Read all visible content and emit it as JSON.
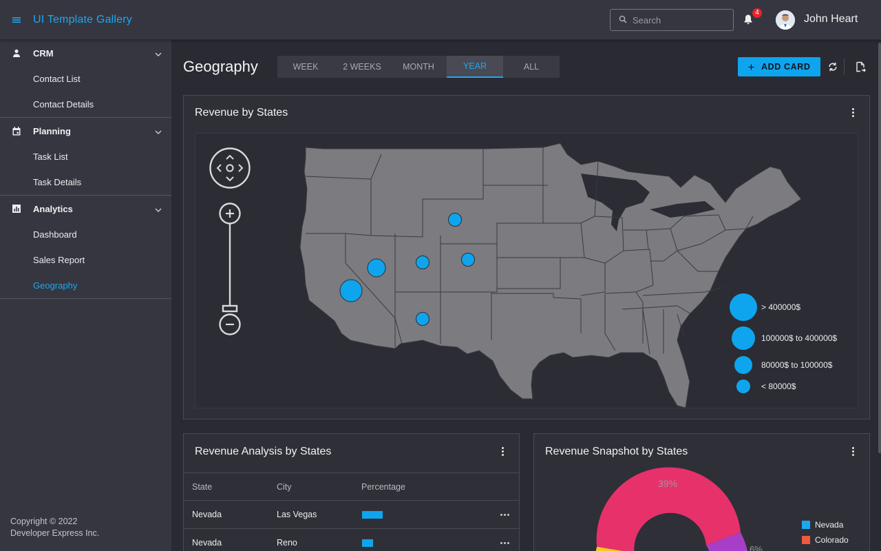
{
  "header": {
    "app_title": "UI Template Gallery",
    "search_placeholder": "Search",
    "notification_count": "4",
    "user_name": "John Heart"
  },
  "sidebar": {
    "groups": [
      {
        "label": "CRM",
        "icon": "person-icon",
        "items": [
          {
            "label": "Contact List"
          },
          {
            "label": "Contact Details"
          }
        ]
      },
      {
        "label": "Planning",
        "icon": "calendar-icon",
        "items": [
          {
            "label": "Task List"
          },
          {
            "label": "Task Details"
          }
        ]
      },
      {
        "label": "Analytics",
        "icon": "bar-chart-icon",
        "items": [
          {
            "label": "Dashboard"
          },
          {
            "label": "Sales Report"
          },
          {
            "label": "Geography",
            "active": true
          }
        ]
      }
    ],
    "footer_line1": "Copyright © 2022",
    "footer_line2": "Developer Express Inc."
  },
  "main": {
    "title": "Geography",
    "tabs": [
      {
        "label": "WEEK"
      },
      {
        "label": "2 WEEKS"
      },
      {
        "label": "MONTH"
      },
      {
        "label": "YEAR",
        "active": true
      },
      {
        "label": "ALL"
      }
    ],
    "add_card_label": "ADD CARD"
  },
  "map_card": {
    "title": "Revenue by States",
    "legend": [
      {
        "label": "> 400000$"
      },
      {
        "label": "100000$ to 400000$"
      },
      {
        "label": "80000$ to 100000$"
      },
      {
        "label": "< 80000$"
      }
    ]
  },
  "table_card": {
    "title": "Revenue Analysis by States",
    "columns": [
      "State",
      "City",
      "Percentage"
    ],
    "rows": [
      {
        "state": "Nevada",
        "city": "Las Vegas",
        "percentage": 0.3
      },
      {
        "state": "Nevada",
        "city": "Reno",
        "percentage": 0.16
      }
    ]
  },
  "pie_card": {
    "title": "Revenue Snapshot by States",
    "slice_labels": [
      "39%",
      "6%"
    ],
    "legend": [
      {
        "label": "Nevada",
        "color": "#1ca8f0"
      },
      {
        "label": "Colorado",
        "color": "#ef5a3d"
      }
    ]
  },
  "colors": {
    "accent": "#1ca8f0",
    "bubble": "#0ea5ee",
    "pie_pink": "#e7316b",
    "pie_purple": "#a63ec8",
    "pie_yellow": "#f6c928"
  }
}
